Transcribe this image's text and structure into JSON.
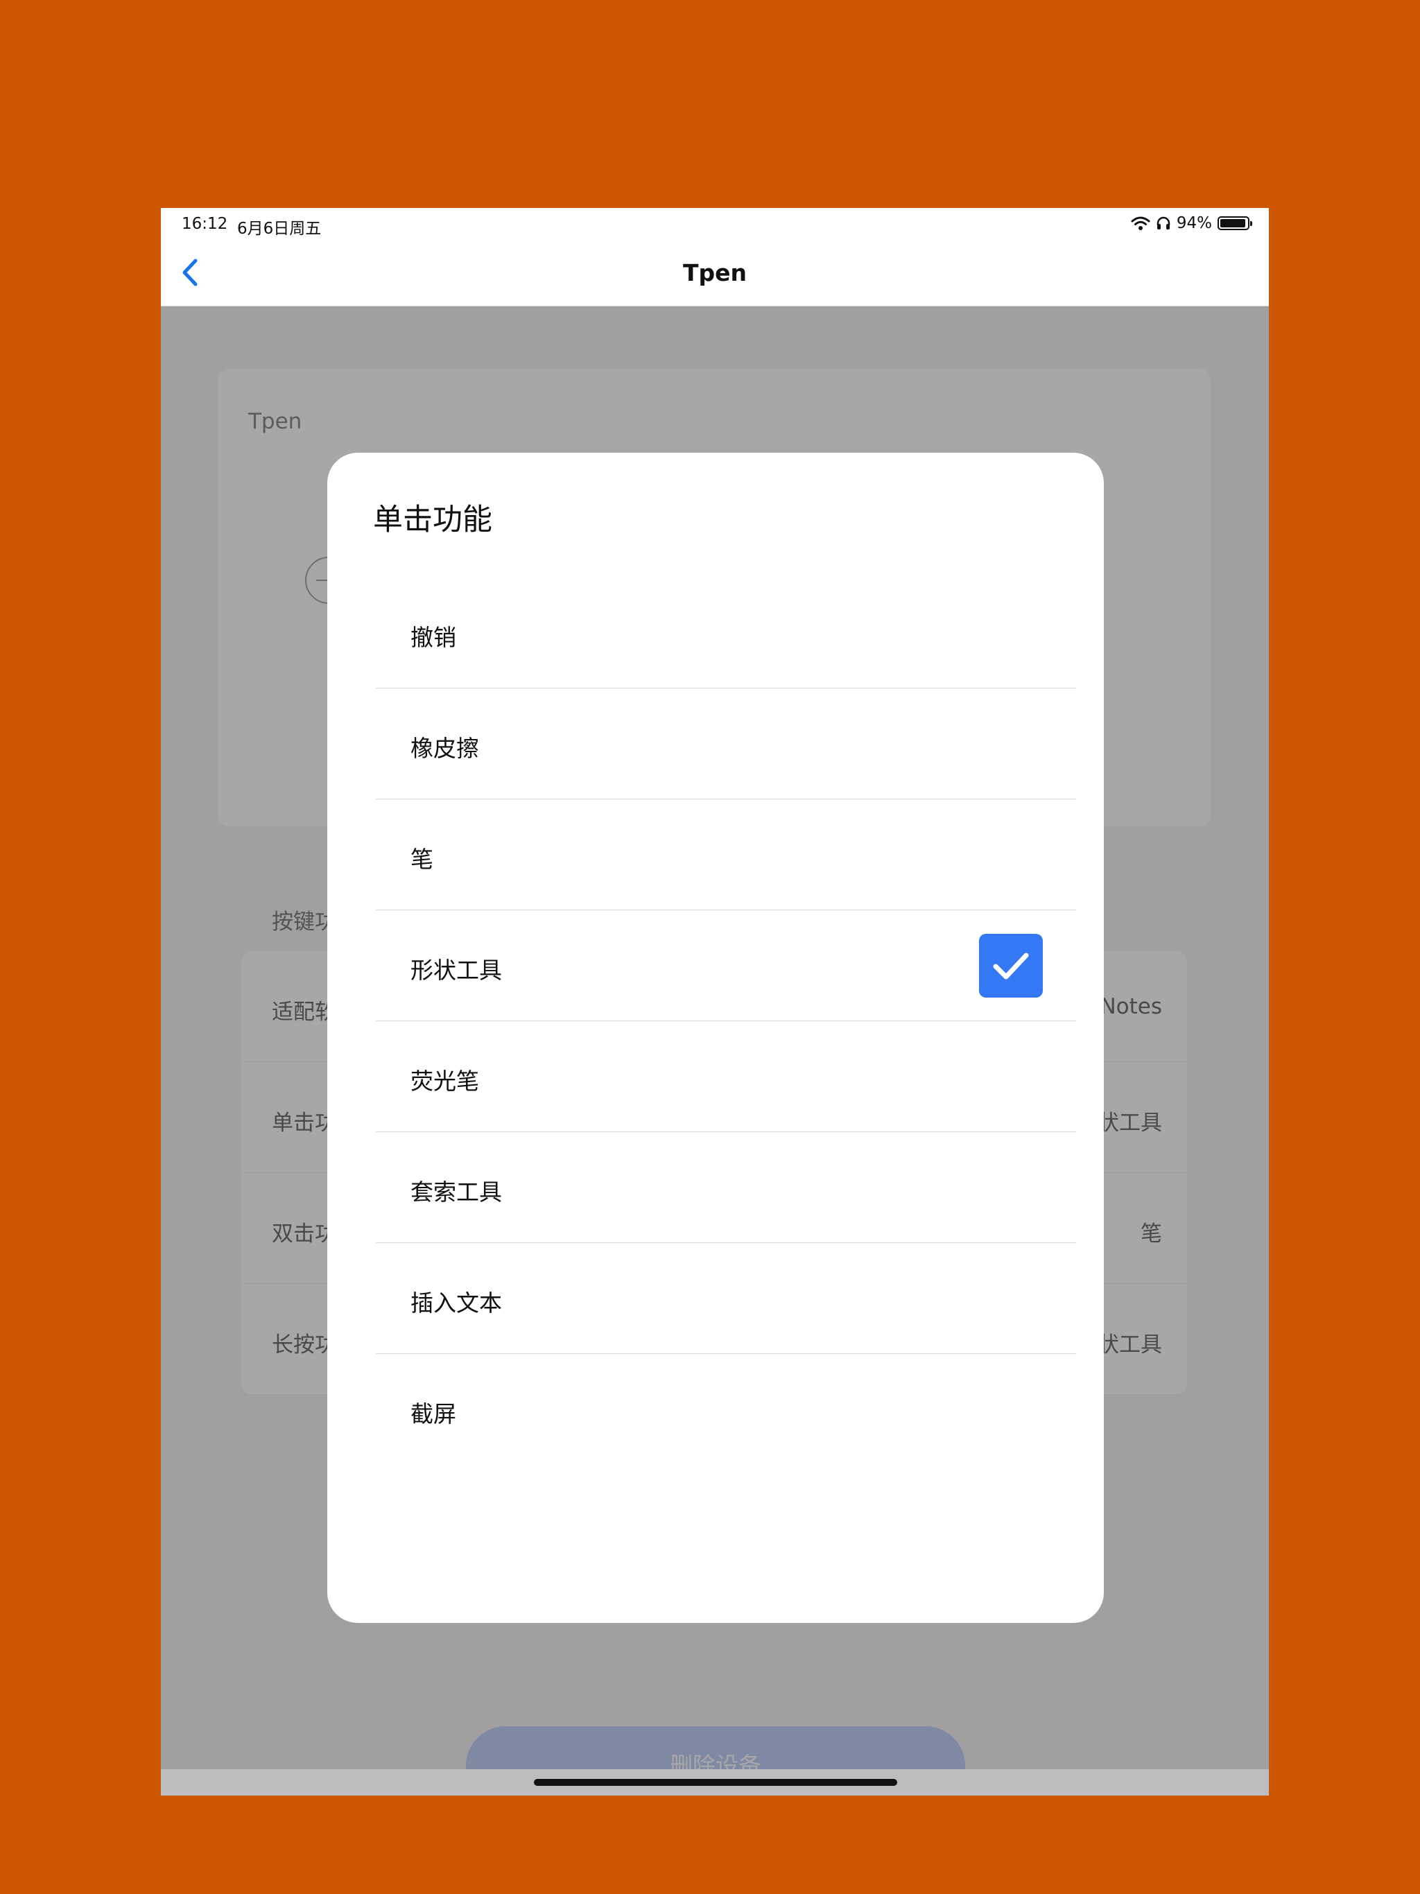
{
  "status_bar": {
    "time": "16:12",
    "date": "6月6日周五",
    "battery_percent": "94%",
    "battery_level": 0.94
  },
  "nav": {
    "title": "Tpen"
  },
  "device_card": {
    "name": "Tpen"
  },
  "key_section": {
    "label": "按键功能"
  },
  "settings": {
    "rows": [
      {
        "label": "适配软件",
        "value": "Notes"
      },
      {
        "label": "单击功能",
        "value": "形状工具"
      },
      {
        "label": "双击功能",
        "value": "笔"
      },
      {
        "label": "长按功能",
        "value": "形状工具"
      }
    ]
  },
  "delete_button": {
    "label": "删除设备"
  },
  "modal": {
    "title": "单击功能",
    "options": [
      {
        "label": "撤销",
        "selected": false
      },
      {
        "label": "橡皮擦",
        "selected": false
      },
      {
        "label": "笔",
        "selected": false
      },
      {
        "label": "形状工具",
        "selected": true
      },
      {
        "label": "荧光笔",
        "selected": false
      },
      {
        "label": "套索工具",
        "selected": false
      },
      {
        "label": "插入文本",
        "selected": false
      },
      {
        "label": "截屏",
        "selected": false
      }
    ]
  },
  "colors": {
    "background": "#CC5602",
    "accent": "#3478F6",
    "delete_button": "#B7C9FA"
  }
}
